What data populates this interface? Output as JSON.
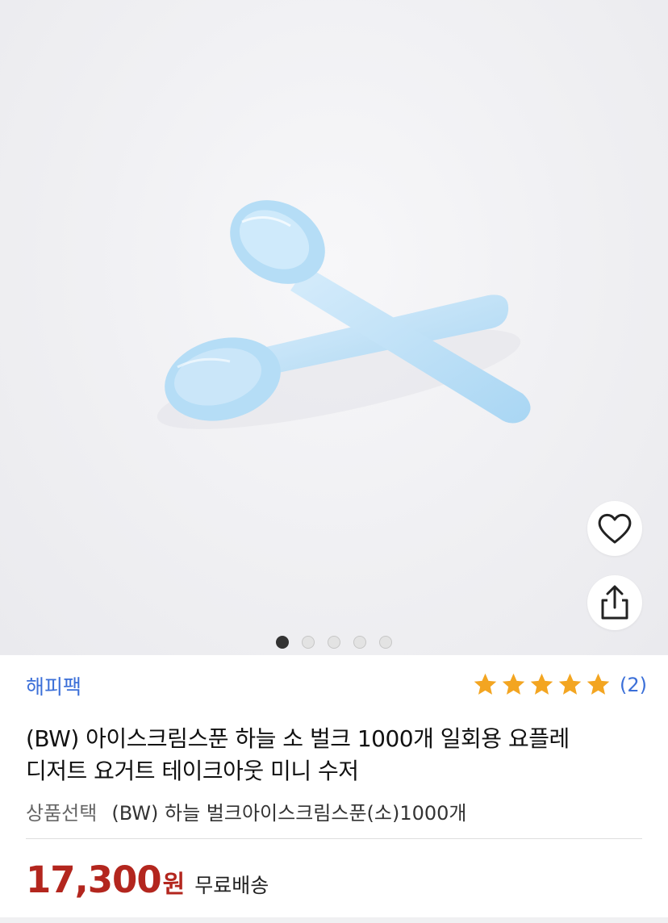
{
  "product_image": {
    "slide_count": 5,
    "active_slide": 1
  },
  "actions": {
    "favorite_icon": "heart-outline-icon",
    "share_icon": "share-upload-icon"
  },
  "seller": {
    "name": "해피팩"
  },
  "rating": {
    "stars": 5,
    "max_stars": 5,
    "count_text": "(2)",
    "star_color": "#f3a521"
  },
  "product": {
    "title_line1": "(BW) 아이스크림스푼 하늘 소 벌크 1000개 일회용 요플레",
    "title_line2": "디저트 요거트 테이크아웃 미니 수저",
    "option_label": "상품선택",
    "option_value": "(BW) 하늘 벌크아이스크림스푼(소)1000개",
    "price": "17,300",
    "currency": "원",
    "shipping": "무료배송"
  },
  "colors": {
    "accent_blue": "#3b6fd8",
    "price_red": "#b3261e"
  }
}
